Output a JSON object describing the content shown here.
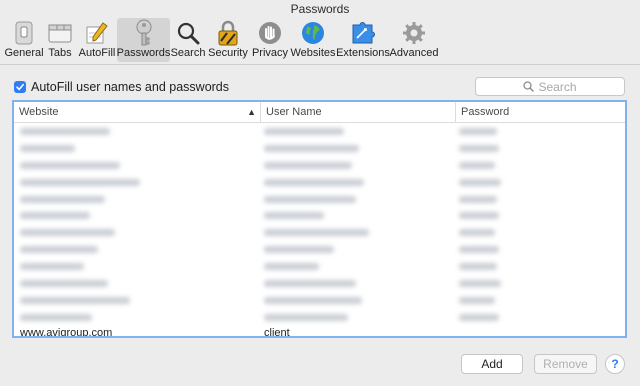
{
  "window": {
    "title": "Passwords"
  },
  "toolbar": {
    "items": [
      {
        "label": "General",
        "icon": "switch-icon"
      },
      {
        "label": "Tabs",
        "icon": "tabs-icon"
      },
      {
        "label": "AutoFill",
        "icon": "pencil-icon"
      },
      {
        "label": "Passwords",
        "icon": "key-icon",
        "selected": true
      },
      {
        "label": "Search",
        "icon": "magnifier-icon"
      },
      {
        "label": "Security",
        "icon": "lock-icon"
      },
      {
        "label": "Privacy",
        "icon": "hand-icon"
      },
      {
        "label": "Websites",
        "icon": "globe-icon"
      },
      {
        "label": "Extensions",
        "icon": "puzzle-icon"
      },
      {
        "label": "Advanced",
        "icon": "gear-icon"
      }
    ]
  },
  "autofill": {
    "label": "AutoFill user names and passwords",
    "checked": true
  },
  "search": {
    "placeholder": "Search"
  },
  "table": {
    "columns": [
      "Website",
      "User Name",
      "Password"
    ],
    "last_row": {
      "website": "www.avigroup.com",
      "username": "client"
    }
  },
  "buttons": {
    "add": "Add",
    "remove": "Remove",
    "help": "?"
  },
  "colors": {
    "accent": "#2f7cf6",
    "selected_tab": "#d4d4d4",
    "table_focus_border": "#7fb2ef"
  }
}
